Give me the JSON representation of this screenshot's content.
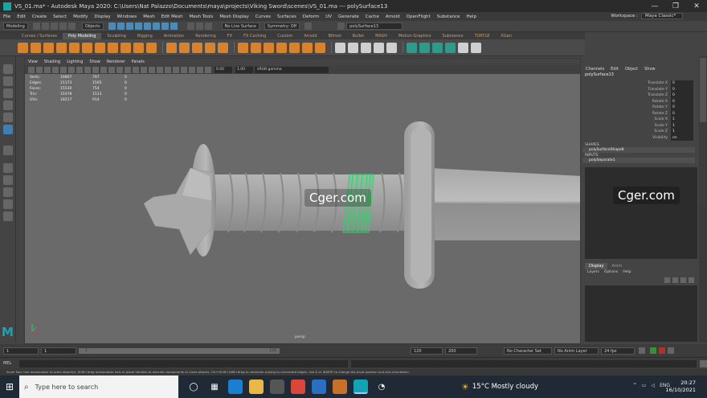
{
  "window": {
    "title": "VS_01.ma* - Autodesk Maya 2020: C:\\Users\\Nat Palazzo\\Documents\\maya\\projects\\Viking Sword\\scenes\\VS_01.ma  ---  polySurface13",
    "controls": [
      "—",
      "❐",
      "✕"
    ]
  },
  "menu": {
    "items": [
      "File",
      "Edit",
      "Create",
      "Select",
      "Modify",
      "Display",
      "Windows",
      "Mesh",
      "Edit Mesh",
      "Mesh Tools",
      "Mesh Display",
      "Curves",
      "Surfaces",
      "Deform",
      "UV",
      "Generate",
      "Cache",
      "Arnold",
      "OpenFlight",
      "Substance",
      "Help"
    ],
    "workspace_label": "Workspace :",
    "workspace_value": "Maya Classic*"
  },
  "status_line": {
    "mode": "Modeling",
    "objects": "Objects",
    "live_surface": "No Live Surface",
    "symmetry": "Symmetry: Off",
    "selected_object": "polySurface13"
  },
  "shelf": {
    "tabs": [
      "Curves / Surfaces",
      "Poly Modeling",
      "Sculpting",
      "Rigging",
      "Animation",
      "Rendering",
      "FX",
      "FX Caching",
      "Custom",
      "Arnold",
      "Bifrost",
      "Bullet",
      "MASH",
      "Motion Graphics",
      "Substance",
      "TURTLE",
      "XGen"
    ],
    "active_tab": "Poly Modeling"
  },
  "viewport": {
    "menu": [
      "View",
      "Shading",
      "Lighting",
      "Show",
      "Renderer",
      "Panels"
    ],
    "exposure": "0.00",
    "gamma": "1.00",
    "color_space": "sRGB gamma",
    "hud": [
      {
        "label": "Verts:",
        "a": "19807",
        "b": "797",
        "c": "0"
      },
      {
        "label": "Edges:",
        "a": "21173",
        "b": "1505",
        "c": "0"
      },
      {
        "label": "Faces:",
        "a": "15530",
        "b": "754",
        "c": "0"
      },
      {
        "label": "Tris:",
        "a": "31078",
        "b": "1513",
        "c": "0"
      },
      {
        "label": "UVs:",
        "a": "18217",
        "b": "914",
        "c": "0"
      }
    ],
    "camera": "persp",
    "watermark": "Cger.com"
  },
  "channel_box": {
    "menu": [
      "Channels",
      "Edit",
      "Object",
      "Show"
    ],
    "object": "polySurface13",
    "attributes": [
      {
        "name": "Translate X",
        "value": "0"
      },
      {
        "name": "Translate Y",
        "value": "0"
      },
      {
        "name": "Translate Z",
        "value": "0"
      },
      {
        "name": "Rotate X",
        "value": "0"
      },
      {
        "name": "Rotate Y",
        "value": "0"
      },
      {
        "name": "Rotate Z",
        "value": "0"
      },
      {
        "name": "Scale X",
        "value": "1"
      },
      {
        "name": "Scale Y",
        "value": "1"
      },
      {
        "name": "Scale Z",
        "value": "1"
      },
      {
        "name": "Visibility",
        "value": "on"
      }
    ],
    "shapes_label": "SHAPES",
    "shape": "polySurfaceShape8",
    "inputs_label": "INPUTS",
    "input": "polySeparate1",
    "watermark": "Cger.com"
  },
  "layer_editor": {
    "tabs": [
      "Display",
      "Anim"
    ],
    "menu": [
      "Layers",
      "Options",
      "Help"
    ]
  },
  "time": {
    "start": "1",
    "current": "1",
    "range_start": "1",
    "range_end": "120",
    "end": "120",
    "anim_end": "200",
    "character_set": "No Character Set",
    "anim_layer": "No Anim Layer",
    "fps": "24 fps"
  },
  "command_line": {
    "label": "MEL"
  },
  "help_line": "Scale Tool: Use manipulator to scale object(s). Shift+drag manipulator axis or plane handles to extrude components or clone objects. Ctrl+Shift+LMB+drag to constrain scaling to connected edges. Use D or INSERT to change the pivot position and axis orientation.",
  "taskbar": {
    "search_placeholder": "Type here to search",
    "weather": "15°C  Mostly cloudy",
    "language": "ENG",
    "time": "20:27",
    "date": "16/10/2021"
  }
}
